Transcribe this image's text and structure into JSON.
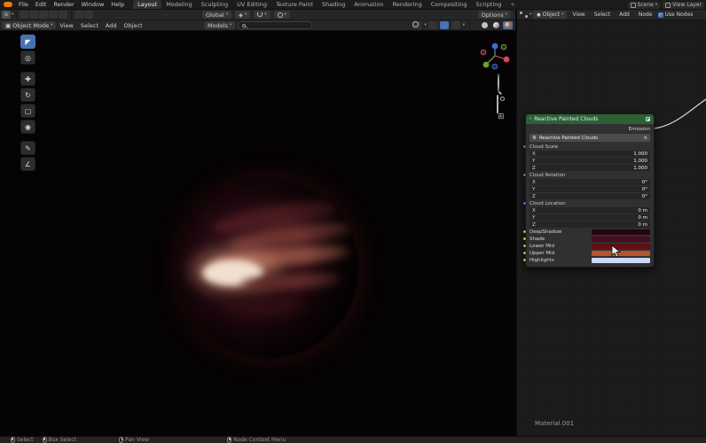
{
  "colors": {
    "accent": "#4772b3",
    "node_header": "#2b6135",
    "socket_color": "#c7b23a",
    "socket_vector": "#6363c7",
    "socket_shader": "#63c763"
  },
  "icons": {
    "caret": "▾",
    "close": "×",
    "check": "✓",
    "gear": "⚙",
    "grid": "⊞",
    "cube": "▣",
    "pivot": "◈",
    "select": "◤",
    "cursor": "◎",
    "move": "✚",
    "rotate": "↻",
    "scale": "▢",
    "transform": "◉",
    "annotate": "✎",
    "measure": "∠",
    "dot": "●"
  },
  "topbar": {
    "menus": [
      "File",
      "Edit",
      "Render",
      "Window",
      "Help"
    ],
    "tabs": [
      "Layout",
      "Modeling",
      "Sculpting",
      "UV Editing",
      "Texture Paint",
      "Shading",
      "Animation",
      "Rendering",
      "Compositing",
      "Scripting"
    ],
    "active_tab": "Layout",
    "new_tab": "+",
    "scene": "Scene",
    "view_layer": "View Layer"
  },
  "tool_settings": {
    "orientation": "Global",
    "options": "Options"
  },
  "viewport_header": {
    "mode": "Object Mode",
    "menus": [
      "View",
      "Select",
      "Add",
      "Object"
    ],
    "asset_filter": "Models",
    "search_value": ""
  },
  "tools": [
    "Select Box",
    "Cursor",
    "Move",
    "Rotate",
    "Scale",
    "Transform",
    "Annotate",
    "Measure"
  ],
  "shader_editor": {
    "type": "Object",
    "menus": [
      "View",
      "Select",
      "Add",
      "Node"
    ],
    "use_nodes": "Use Nodes",
    "material": "Material.001"
  },
  "node": {
    "title": "Reactive Painted Clouds",
    "output": "Emission",
    "group": "Reactive Painted Clouds",
    "sections": [
      {
        "label": "Cloud Scale",
        "rows": [
          [
            "X",
            "1.000"
          ],
          [
            "Y",
            "1.000"
          ],
          [
            "Z",
            "1.000"
          ]
        ]
      },
      {
        "label": "Cloud Rotation",
        "rows": [
          [
            "X",
            "0°"
          ],
          [
            "Y",
            "0°"
          ],
          [
            "Z",
            "0°"
          ]
        ]
      },
      {
        "label": "Cloud Location",
        "rows": [
          [
            "X",
            "0 m"
          ],
          [
            "Y",
            "0 m"
          ],
          [
            "Z",
            "0 m"
          ]
        ]
      }
    ],
    "colors": [
      {
        "label": "DeepShadow",
        "color": "#26040c"
      },
      {
        "label": "Shade",
        "color": "#470b1f"
      },
      {
        "label": "Lower Mid",
        "color": "#640d14"
      },
      {
        "label": "Upper Mid",
        "color": "#b5562e"
      },
      {
        "label": "Highlights",
        "color": "#ccdaf5"
      }
    ]
  },
  "statusbar": {
    "items": [
      "Select",
      "Box Select",
      "Pan View",
      "Node Context Menu"
    ]
  }
}
